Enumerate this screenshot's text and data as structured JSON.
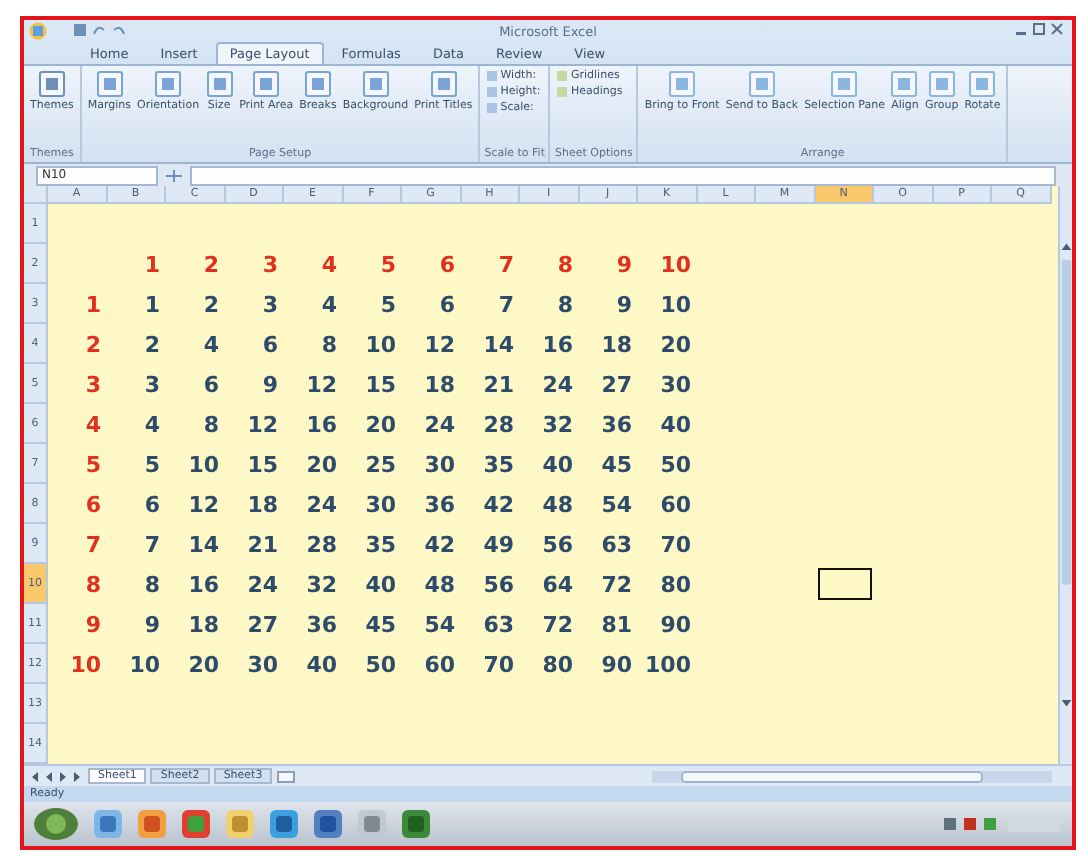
{
  "window": {
    "title": "Microsoft Excel"
  },
  "ribbon_tabs": [
    {
      "label": "Home",
      "selected": false
    },
    {
      "label": "Insert",
      "selected": false
    },
    {
      "label": "Page Layout",
      "selected": true
    },
    {
      "label": "Formulas",
      "selected": false
    },
    {
      "label": "Data",
      "selected": false
    },
    {
      "label": "Review",
      "selected": false
    },
    {
      "label": "View",
      "selected": false
    }
  ],
  "ribbon_groups": [
    {
      "label": "Themes",
      "buttons": [
        "Themes"
      ]
    },
    {
      "label": "Page Setup",
      "buttons": [
        "Margins",
        "Orientation",
        "Size",
        "Print Area",
        "Breaks",
        "Background",
        "Print Titles"
      ]
    },
    {
      "label": "Scale to Fit",
      "buttons": [
        "Width:",
        "Height:",
        "Scale:"
      ]
    },
    {
      "label": "Sheet Options",
      "buttons": [
        "Gridlines",
        "Headings"
      ]
    },
    {
      "label": "Arrange",
      "buttons": [
        "Bring to Front",
        "Send to Back",
        "Selection Pane",
        "Align",
        "Group",
        "Rotate"
      ]
    }
  ],
  "name_box": "N10",
  "columns": [
    {
      "label": "A",
      "selected": false
    },
    {
      "label": "B",
      "selected": false
    },
    {
      "label": "C",
      "selected": false
    },
    {
      "label": "D",
      "selected": false
    },
    {
      "label": "E",
      "selected": false
    },
    {
      "label": "F",
      "selected": false
    },
    {
      "label": "G",
      "selected": false
    },
    {
      "label": "H",
      "selected": false
    },
    {
      "label": "I",
      "selected": false
    },
    {
      "label": "J",
      "selected": false
    },
    {
      "label": "K",
      "selected": false
    },
    {
      "label": "L",
      "selected": false
    },
    {
      "label": "M",
      "selected": false
    },
    {
      "label": "N",
      "selected": true
    },
    {
      "label": "O",
      "selected": false
    },
    {
      "label": "P",
      "selected": false
    },
    {
      "label": "Q",
      "selected": false
    }
  ],
  "row_headers": [
    {
      "label": "1",
      "selected": false
    },
    {
      "label": "2",
      "selected": false
    },
    {
      "label": "3",
      "selected": false
    },
    {
      "label": "4",
      "selected": false
    },
    {
      "label": "5",
      "selected": false
    },
    {
      "label": "6",
      "selected": false
    },
    {
      "label": "7",
      "selected": false
    },
    {
      "label": "8",
      "selected": false
    },
    {
      "label": "9",
      "selected": false
    },
    {
      "label": "10",
      "selected": true
    },
    {
      "label": "11",
      "selected": false
    },
    {
      "label": "12",
      "selected": false
    },
    {
      "label": "13",
      "selected": false
    },
    {
      "label": "14",
      "selected": false
    }
  ],
  "table": {
    "header": [
      "1",
      "2",
      "3",
      "4",
      "5",
      "6",
      "7",
      "8",
      "9",
      "10"
    ],
    "rows": [
      {
        "label": "1",
        "values": [
          "1",
          "2",
          "3",
          "4",
          "5",
          "6",
          "7",
          "8",
          "9",
          "10"
        ]
      },
      {
        "label": "2",
        "values": [
          "2",
          "4",
          "6",
          "8",
          "10",
          "12",
          "14",
          "16",
          "18",
          "20"
        ]
      },
      {
        "label": "3",
        "values": [
          "3",
          "6",
          "9",
          "12",
          "15",
          "18",
          "21",
          "24",
          "27",
          "30"
        ]
      },
      {
        "label": "4",
        "values": [
          "4",
          "8",
          "12",
          "16",
          "20",
          "24",
          "28",
          "32",
          "36",
          "40"
        ]
      },
      {
        "label": "5",
        "values": [
          "5",
          "10",
          "15",
          "20",
          "25",
          "30",
          "35",
          "40",
          "45",
          "50"
        ]
      },
      {
        "label": "6",
        "values": [
          "6",
          "12",
          "18",
          "24",
          "30",
          "36",
          "42",
          "48",
          "54",
          "60"
        ]
      },
      {
        "label": "7",
        "values": [
          "7",
          "14",
          "21",
          "28",
          "35",
          "42",
          "49",
          "56",
          "63",
          "70"
        ]
      },
      {
        "label": "8",
        "values": [
          "8",
          "16",
          "24",
          "32",
          "40",
          "48",
          "56",
          "64",
          "72",
          "80"
        ]
      },
      {
        "label": "9",
        "values": [
          "9",
          "18",
          "27",
          "36",
          "45",
          "54",
          "63",
          "72",
          "81",
          "90"
        ]
      },
      {
        "label": "10",
        "values": [
          "10",
          "20",
          "30",
          "40",
          "50",
          "60",
          "70",
          "80",
          "90",
          "100"
        ]
      }
    ]
  },
  "sheet_tabs": [
    {
      "label": "Sheet1",
      "selected": true
    },
    {
      "label": "Sheet2",
      "selected": false
    },
    {
      "label": "Sheet3",
      "selected": false
    }
  ],
  "status_bar": {
    "text": "Ready"
  }
}
